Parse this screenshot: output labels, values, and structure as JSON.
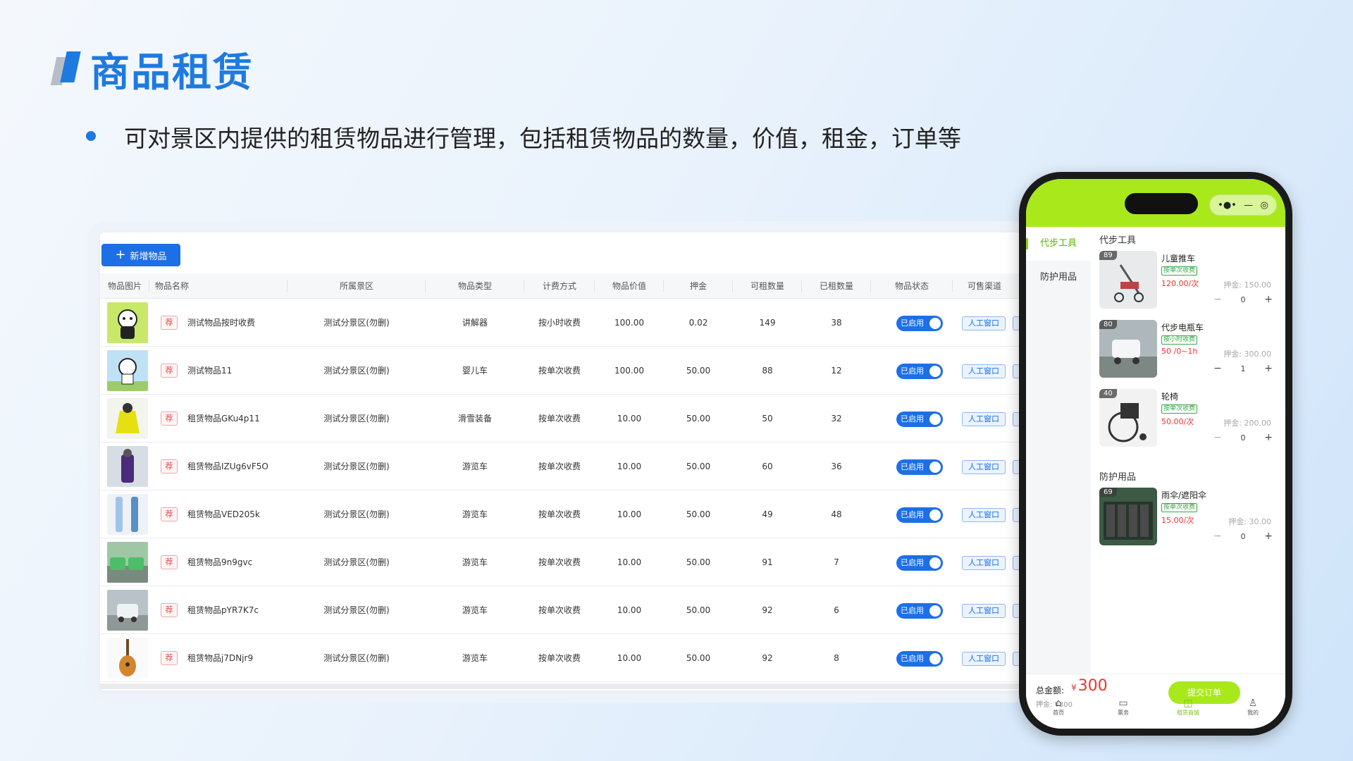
{
  "slide": {
    "title": "商品租赁",
    "description": "可对景区内提供的租赁物品进行管理，包括租赁物品的数量，价值，租金，订单等"
  },
  "admin": {
    "add_button": "新增物品",
    "columns": [
      "物品图片",
      "物品名称",
      "所属景区",
      "物品类型",
      "计费方式",
      "物品价值",
      "押金",
      "可租数量",
      "已租数量",
      "物品状态",
      "可售渠道"
    ],
    "tag_label": "荐",
    "rows": [
      {
        "name": "测试物品按时收费",
        "area": "测试分景区(勿删)",
        "type": "讲解器",
        "billing": "按小时收费",
        "value": "100.00",
        "deposit": "0.02",
        "available": "149",
        "rented": "38",
        "status": "已启用",
        "channel": "人工窗口"
      },
      {
        "name": "测试物品11",
        "area": "测试分景区(勿删)",
        "type": "婴儿车",
        "billing": "按单次收费",
        "value": "100.00",
        "deposit": "50.00",
        "available": "88",
        "rented": "12",
        "status": "已启用",
        "channel": "人工窗口"
      },
      {
        "name": "租赁物品GKu4p11",
        "area": "测试分景区(勿删)",
        "type": "滑雪装备",
        "billing": "按单次收费",
        "value": "10.00",
        "deposit": "50.00",
        "available": "50",
        "rented": "32",
        "status": "已启用",
        "channel": "人工窗口"
      },
      {
        "name": "租赁物品IZUg6vF5O",
        "area": "测试分景区(勿删)",
        "type": "游览车",
        "billing": "按单次收费",
        "value": "10.00",
        "deposit": "50.00",
        "available": "60",
        "rented": "36",
        "status": "已启用",
        "channel": "人工窗口"
      },
      {
        "name": "租赁物品VED205k",
        "area": "测试分景区(勿删)",
        "type": "游览车",
        "billing": "按单次收费",
        "value": "10.00",
        "deposit": "50.00",
        "available": "49",
        "rented": "48",
        "status": "已启用",
        "channel": "人工窗口"
      },
      {
        "name": "租赁物品9n9gvc",
        "area": "测试分景区(勿删)",
        "type": "游览车",
        "billing": "按单次收费",
        "value": "10.00",
        "deposit": "50.00",
        "available": "91",
        "rented": "7",
        "status": "已启用",
        "channel": "人工窗口"
      },
      {
        "name": "租赁物品pYR7K7c",
        "area": "测试分景区(勿删)",
        "type": "游览车",
        "billing": "按单次收费",
        "value": "10.00",
        "deposit": "50.00",
        "available": "92",
        "rented": "6",
        "status": "已启用",
        "channel": "人工窗口"
      },
      {
        "name": "租赁物品j7DNjr9",
        "area": "测试分景区(勿删)",
        "type": "游览车",
        "billing": "按单次收费",
        "value": "10.00",
        "deposit": "50.00",
        "available": "92",
        "rented": "8",
        "status": "已启用",
        "channel": "人工窗口"
      }
    ]
  },
  "phone": {
    "capsule_more": "•●•",
    "capsule_min": "—",
    "capsule_close": "◎",
    "sidebar": [
      {
        "label": "代步工具",
        "active": true
      },
      {
        "label": "防护用品",
        "active": false
      }
    ],
    "sections": [
      {
        "title": "代步工具",
        "items": [
          {
            "name": "儿童推车",
            "badge": "按单次收费",
            "price": "120.00/次",
            "deposit": "押金: 150.00",
            "qty": "0",
            "stock": "89"
          },
          {
            "name": "代步电瓶车",
            "badge": "按小时收费",
            "price": "50 /0~1h",
            "deposit": "押金: 300.00",
            "qty": "1",
            "stock": "80"
          },
          {
            "name": "轮椅",
            "badge": "按单次收费",
            "price": "50.00/次",
            "deposit": "押金: 200.00",
            "qty": "0",
            "stock": "40"
          }
        ]
      },
      {
        "title": "防护用品",
        "items": [
          {
            "name": "雨伞/遮阳伞",
            "badge": "按单次收费",
            "price": "15.00/次",
            "deposit": "押金: 30.00",
            "qty": "0",
            "stock": "69"
          }
        ]
      }
    ],
    "total_label": "总金额:",
    "currency": "¥",
    "total_value": "300",
    "deposit_total": "押金: ¥300",
    "submit_label": "提交订单",
    "tabs": [
      {
        "label": "首页",
        "icon": "home-icon",
        "active": false
      },
      {
        "label": "票务",
        "icon": "ticket-icon",
        "active": false
      },
      {
        "label": "租赁商城",
        "icon": "bag-icon",
        "active": true
      },
      {
        "label": "我的",
        "icon": "user-icon",
        "active": false
      }
    ]
  }
}
